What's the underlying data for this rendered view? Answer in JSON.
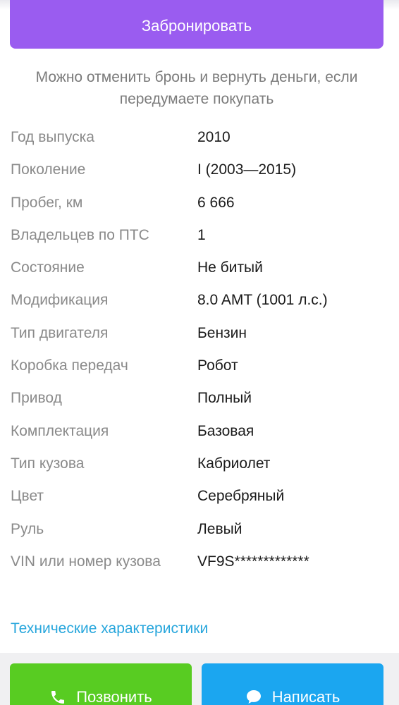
{
  "booking": {
    "button_label": "Забронировать",
    "note": "Можно отменить бронь и вернуть деньги, если передумаете покупать"
  },
  "specs": [
    {
      "label": "Год выпуска",
      "value": "2010"
    },
    {
      "label": "Поколение",
      "value": "I (2003—2015)"
    },
    {
      "label": "Пробег, км",
      "value": "6 666"
    },
    {
      "label": "Владельцев по ПТС",
      "value": "1"
    },
    {
      "label": "Состояние",
      "value": "Не битый"
    },
    {
      "label": "Модификация",
      "value": "8.0 AMT (1001 л.с.)"
    },
    {
      "label": "Тип двигателя",
      "value": "Бензин"
    },
    {
      "label": "Коробка передач",
      "value": "Робот"
    },
    {
      "label": "Привод",
      "value": "Полный"
    },
    {
      "label": "Комплектация",
      "value": "Базовая"
    },
    {
      "label": "Тип кузова",
      "value": "Кабриолет"
    },
    {
      "label": "Цвет",
      "value": "Серебряный"
    },
    {
      "label": "Руль",
      "value": "Левый"
    },
    {
      "label": "VIN или номер кузова",
      "value": "VF9S*************"
    }
  ],
  "tech_link": "Технические характеристики",
  "actions": {
    "call_label": "Позвонить",
    "call_icon": "phone-icon",
    "write_label": "Написать",
    "write_icon": "chat-bubble-icon"
  },
  "colors": {
    "book_button": "#9a5cf0",
    "call_button": "#58cc22",
    "write_button": "#1ba6f0",
    "link": "#27a6dc"
  }
}
